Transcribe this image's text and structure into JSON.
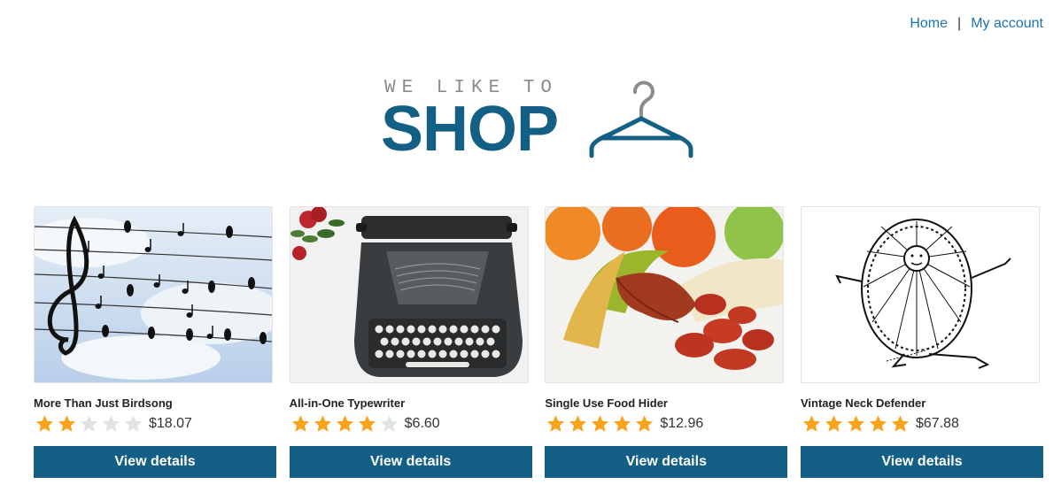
{
  "nav": {
    "home_label": "Home",
    "separator": "|",
    "account_label": "My account"
  },
  "logo": {
    "tagline": "WE LIKE TO",
    "word": "SHOP",
    "icon": "hanger-icon",
    "color": "#135f86"
  },
  "products": [
    {
      "title": "More Than Just Birdsong",
      "rating": 2,
      "max_rating": 5,
      "price": "$18.07",
      "button_label": "View details",
      "image": "birds-on-wires-image"
    },
    {
      "title": "All-in-One Typewriter",
      "rating": 4,
      "max_rating": 5,
      "price": "$6.60",
      "button_label": "View details",
      "image": "typewriter-image"
    },
    {
      "title": "Single Use Food Hider",
      "rating": 5,
      "max_rating": 5,
      "price": "$12.96",
      "button_label": "View details",
      "image": "banana-sausage-image"
    },
    {
      "title": "Vintage Neck Defender",
      "rating": 5,
      "max_rating": 5,
      "price": "$67.88",
      "button_label": "View details",
      "image": "vintage-collar-illustration"
    }
  ],
  "colors": {
    "accent": "#135f86",
    "link": "#1a73b5",
    "star_filled": "#f7a31c",
    "star_empty": "#dfe3e6"
  }
}
